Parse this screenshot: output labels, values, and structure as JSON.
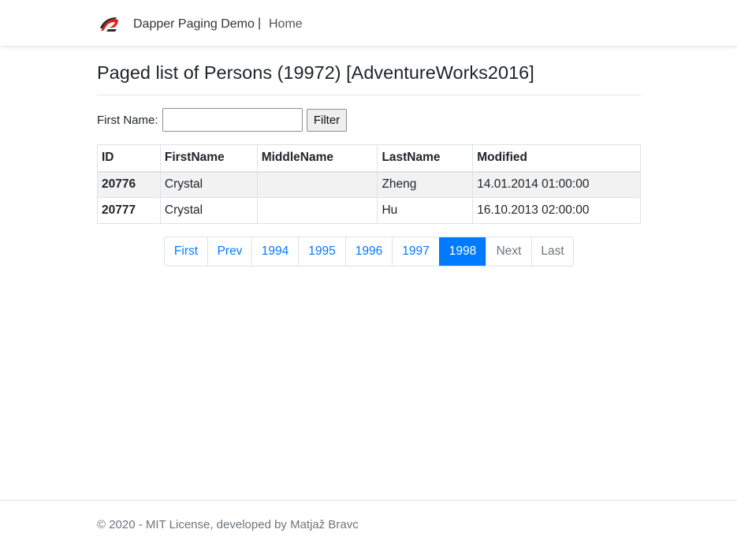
{
  "navbar": {
    "brand": "Dapper Paging Demo",
    "separator": "|",
    "home": "Home"
  },
  "main": {
    "title": "Paged list of Persons (19972) [AdventureWorks2016]",
    "filter": {
      "label": "First Name:",
      "value": "",
      "button": "Filter"
    },
    "table": {
      "columns": [
        "ID",
        "FirstName",
        "MiddleName",
        "LastName",
        "Modified"
      ],
      "rows": [
        [
          "20776",
          "Crystal",
          "",
          "Zheng",
          "14.01.2014 01:00:00"
        ],
        [
          "20777",
          "Crystal",
          "",
          "Hu",
          "16.10.2013 02:00:00"
        ]
      ]
    },
    "pager": {
      "items": [
        {
          "label": "First",
          "state": "link"
        },
        {
          "label": "Prev",
          "state": "link"
        },
        {
          "label": "1994",
          "state": "link"
        },
        {
          "label": "1995",
          "state": "link"
        },
        {
          "label": "1996",
          "state": "link"
        },
        {
          "label": "1997",
          "state": "link"
        },
        {
          "label": "1998",
          "state": "active"
        },
        {
          "label": "Next",
          "state": "disabled"
        },
        {
          "label": "Last",
          "state": "disabled"
        }
      ]
    }
  },
  "footer": {
    "text": "© 2020 - MIT License, developed by Matjaž Bravc"
  },
  "colors": {
    "link": "#007bff",
    "active": "#007bff",
    "disabled": "#6c757d",
    "logo_red": "#e0201f",
    "logo_dark": "#2b2b2b"
  },
  "icons": {
    "logo": "dapper-logo-icon"
  }
}
